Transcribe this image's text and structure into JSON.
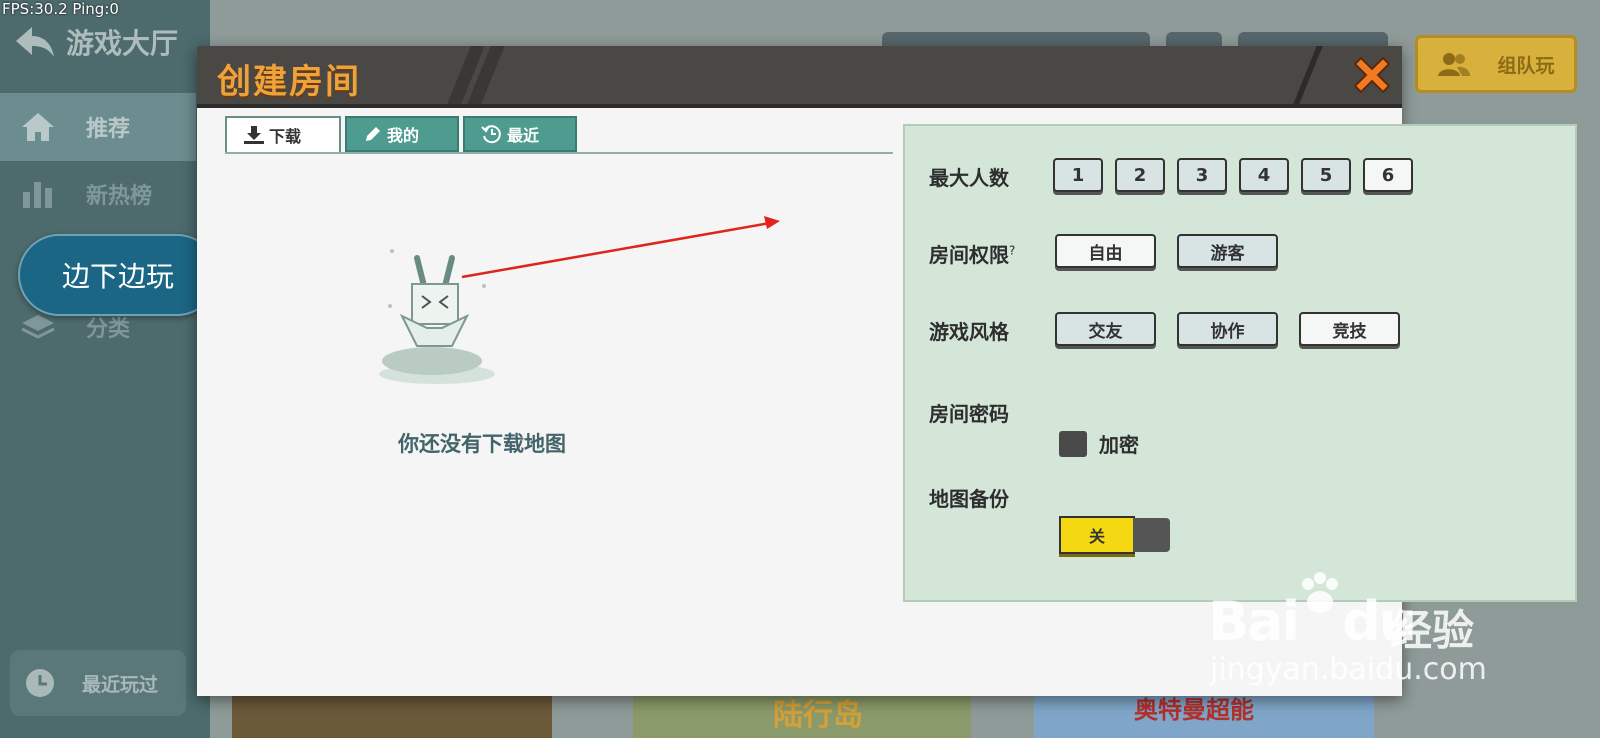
{
  "overlay": {
    "fps_text": "FPS:30.2  Ping:0"
  },
  "background": {
    "lobby_title": "游戏大厅",
    "sidebar": [
      {
        "label": "推荐",
        "icon": "home-icon",
        "active": true
      },
      {
        "label": "新热榜",
        "icon": "chart-icon",
        "active": false
      },
      {
        "label": "分类",
        "icon": "layers-icon",
        "active": false
      }
    ],
    "recent_played": "最近玩过",
    "team_button": "组队玩",
    "thumb_label_1": "陆行岛",
    "thumb_label_2": "奥特曼超能"
  },
  "floating": {
    "play_while_download": "边下边玩"
  },
  "dialog": {
    "title": "创建房间",
    "tabs": [
      {
        "label": "下载",
        "icon": "download-icon",
        "active": true
      },
      {
        "label": "我的",
        "icon": "pencil-icon",
        "active": false
      },
      {
        "label": "最近",
        "icon": "history-icon",
        "active": false
      }
    ],
    "empty_text": "你还没有下载地图",
    "settings": {
      "max_players": {
        "label": "最大人数",
        "options": [
          "1",
          "2",
          "3",
          "4",
          "5",
          "6"
        ],
        "selected": "6"
      },
      "permission": {
        "label": "房间权限",
        "help": "?",
        "options": [
          "自由",
          "游客"
        ],
        "selected": "自由"
      },
      "style": {
        "label": "游戏风格",
        "options": [
          "交友",
          "协作",
          "竞技"
        ],
        "selected": "竞技"
      },
      "password": {
        "label": "房间密码",
        "checkbox_label": "加密",
        "checked": false
      },
      "backup": {
        "label": "地图备份",
        "toggle_label": "关"
      }
    }
  },
  "watermark": {
    "brand": "Bai",
    "brand2": "du",
    "cn": "经验",
    "url": "jingyan.baidu.com"
  },
  "colors": {
    "title_orange": "#f0a23a",
    "panel_green": "#d3e6d8",
    "toggle_yellow": "#f5d814",
    "arrow_red": "#e0241b"
  }
}
